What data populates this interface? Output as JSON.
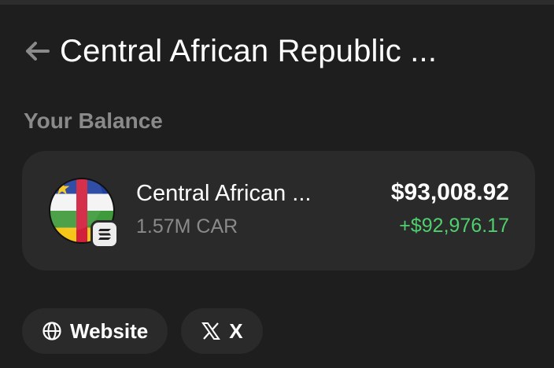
{
  "header": {
    "title": "Central African Republic ...",
    "back_icon": "arrow-left-icon"
  },
  "balance": {
    "section_label": "Your Balance",
    "token": {
      "name": "Central African ...",
      "amount": "1.57M CAR",
      "usd_value": "$93,008.92",
      "pnl": "+$92,976.17",
      "logo_icon": "central-african-republic-flag-icon",
      "chain_icon": "solana-icon"
    }
  },
  "links": [
    {
      "label": "Website",
      "icon": "globe-icon"
    },
    {
      "label": "X",
      "icon": "x-logo-icon"
    }
  ],
  "colors": {
    "background": "#1e1e1e",
    "card": "#2a2a2a",
    "muted_text": "#8a8a8a",
    "positive": "#4fcf6e"
  }
}
